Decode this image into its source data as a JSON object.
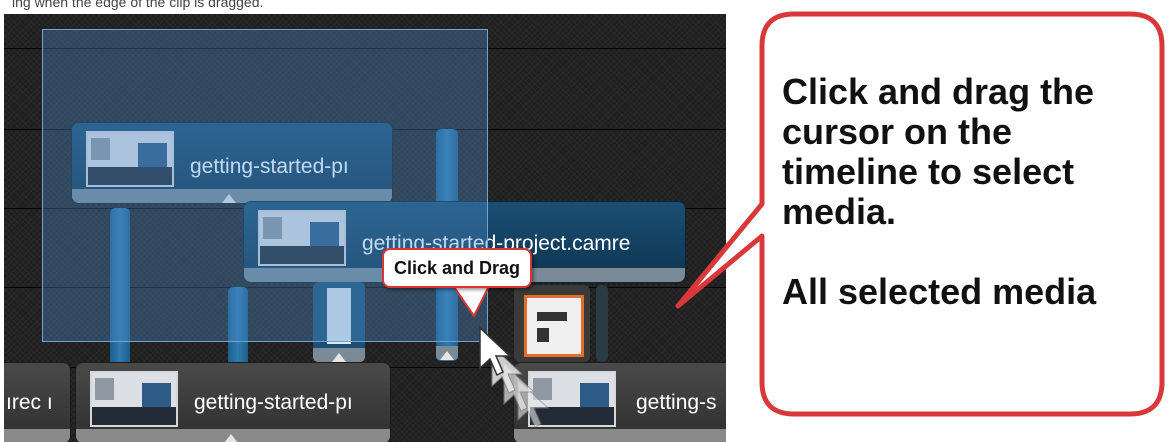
{
  "top_strip": {
    "text": "ing when the edge of the clip is dragged."
  },
  "timeline": {
    "clips": {
      "upper": "getting-started-pı",
      "middle": "getting-started-project.camre",
      "bottom_left_cut": "ırec ı",
      "bottom_center": "getting-started-pı",
      "bottom_right": "getting-s"
    },
    "tooltip": "Click and Drag"
  },
  "callout": {
    "text": "Click and drag the\ncursor on the\ntimeline to select\nmedia.\n\nAll selected media"
  },
  "colors": {
    "callout_border": "#d9383a",
    "selection_fill": "#4f8fce",
    "clip_blue": "#174a6c",
    "timeline_bg": "#1f1f1f"
  }
}
